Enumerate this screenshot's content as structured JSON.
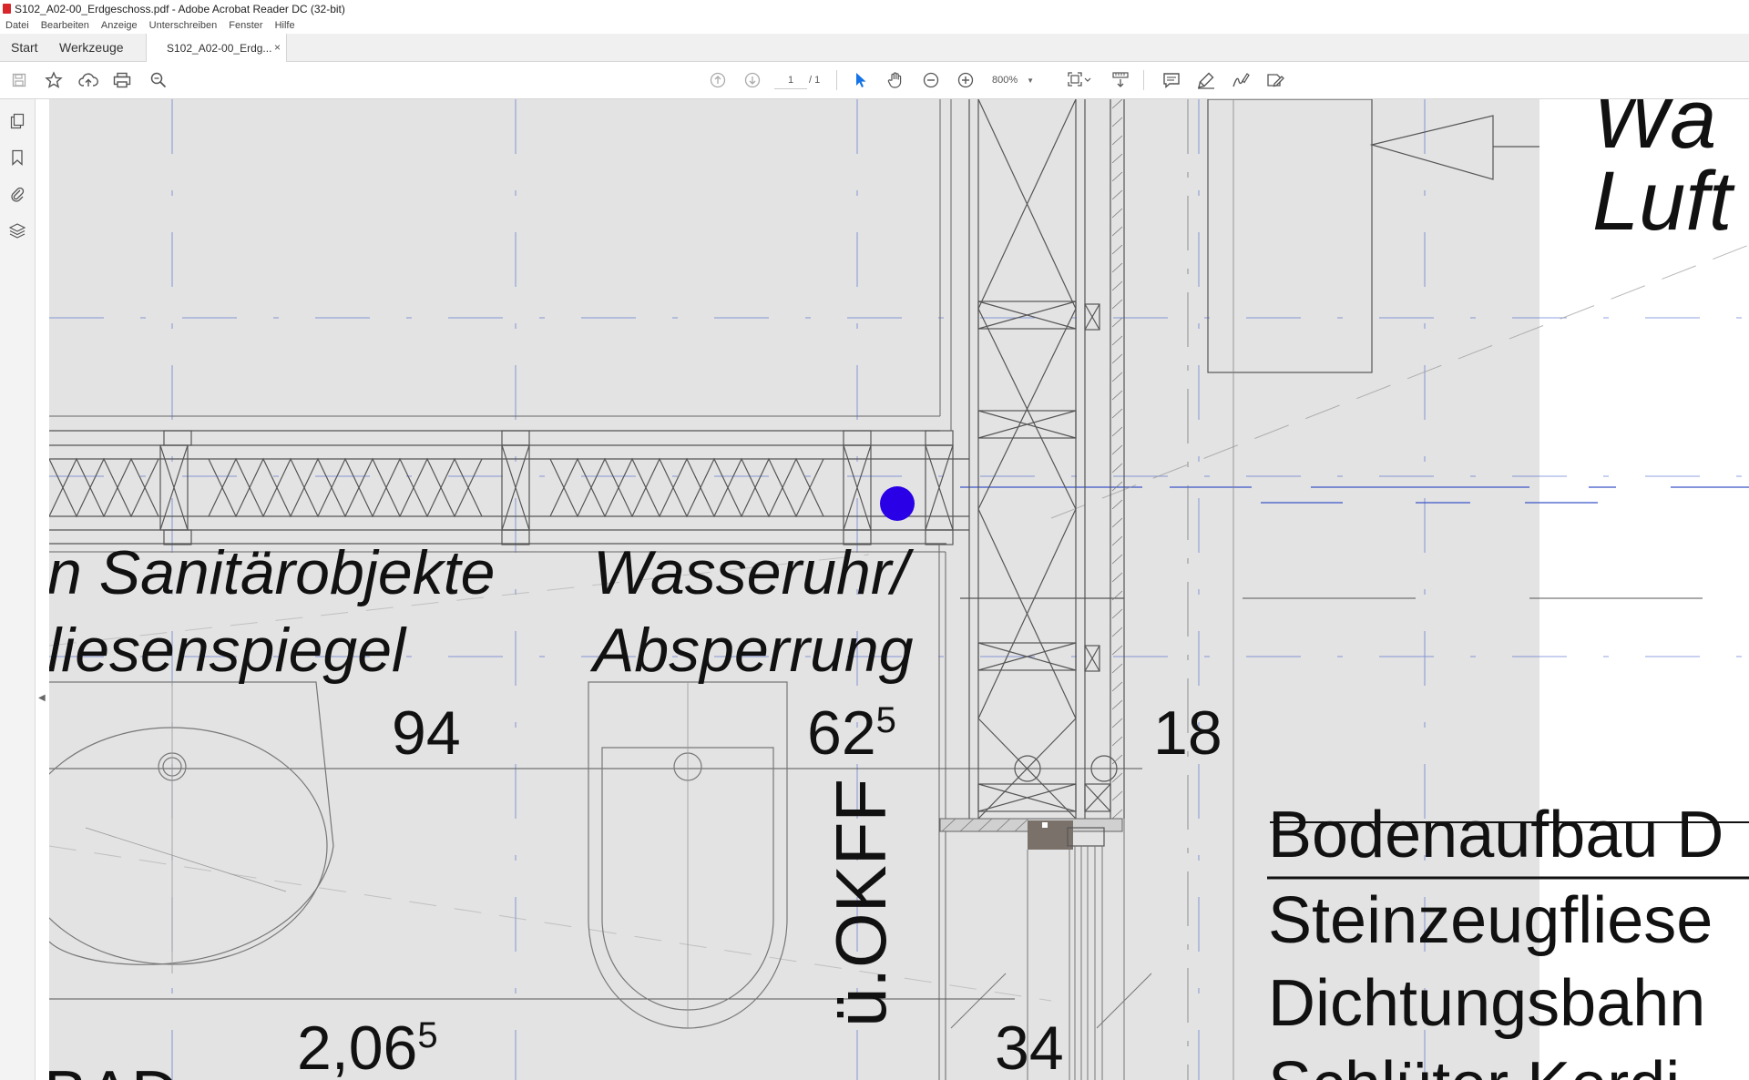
{
  "window": {
    "title": "S102_A02-00_Erdgeschoss.pdf - Adobe Acrobat Reader DC (32-bit)"
  },
  "menu": [
    "Datei",
    "Bearbeiten",
    "Anzeige",
    "Unterschreiben",
    "Fenster",
    "Hilfe"
  ],
  "tabs": {
    "start": "Start",
    "tools": "Werkzeuge",
    "doc": "S102_A02-00_Erdg...",
    "close": "×"
  },
  "toolbar": {
    "page_current": "1",
    "page_total": "/ 1",
    "zoom": "800%"
  },
  "icons": {
    "toolbar_left": [
      "save-icon",
      "bookmark-star-icon",
      "cloud-upload-icon",
      "print-icon",
      "zoom-search-icon"
    ],
    "toolbar_center": [
      "prev-page-icon",
      "next-page-icon",
      "select-cursor-icon",
      "hand-tool-icon",
      "zoom-out-icon",
      "zoom-in-icon",
      "page-fit-icon",
      "scroll-mode-icon"
    ],
    "toolbar_right": [
      "comment-icon",
      "highlight-icon",
      "sign-icon",
      "edit-pdf-icon"
    ],
    "rail": [
      "pages-icon",
      "bookmarks-icon",
      "attachments-icon",
      "layers-icon"
    ]
  },
  "drawing": {
    "labels": {
      "sanitaer_1": "n Sanitärobjekte",
      "sanitaer_2": "liesenspiegel",
      "wasser_1": "Wasseruhr/",
      "wasser_2": "Absperrung",
      "dim_94": "94",
      "dim_625": "62",
      "dim_625_sup": "5",
      "dim_18": "18",
      "dim_2065": "2,06",
      "dim_2065_sup": "5",
      "dim_34": "34",
      "okff": "ü.OKFF",
      "top_1": "Wa",
      "top_2": "Luft",
      "boden_title": "Bodenaufbau D",
      "boden_1": "Steinzeugfliese",
      "boden_2": "Dichtungsbahn",
      "boden_3": "Schlüter Kerdi",
      "bad": "BAD"
    },
    "colors": {
      "background": "#e3e3e3",
      "white_zone": "#ffffff",
      "marker": "#2a00e6",
      "axis_line": "#3a54c7",
      "wall_line": "#555555"
    }
  }
}
